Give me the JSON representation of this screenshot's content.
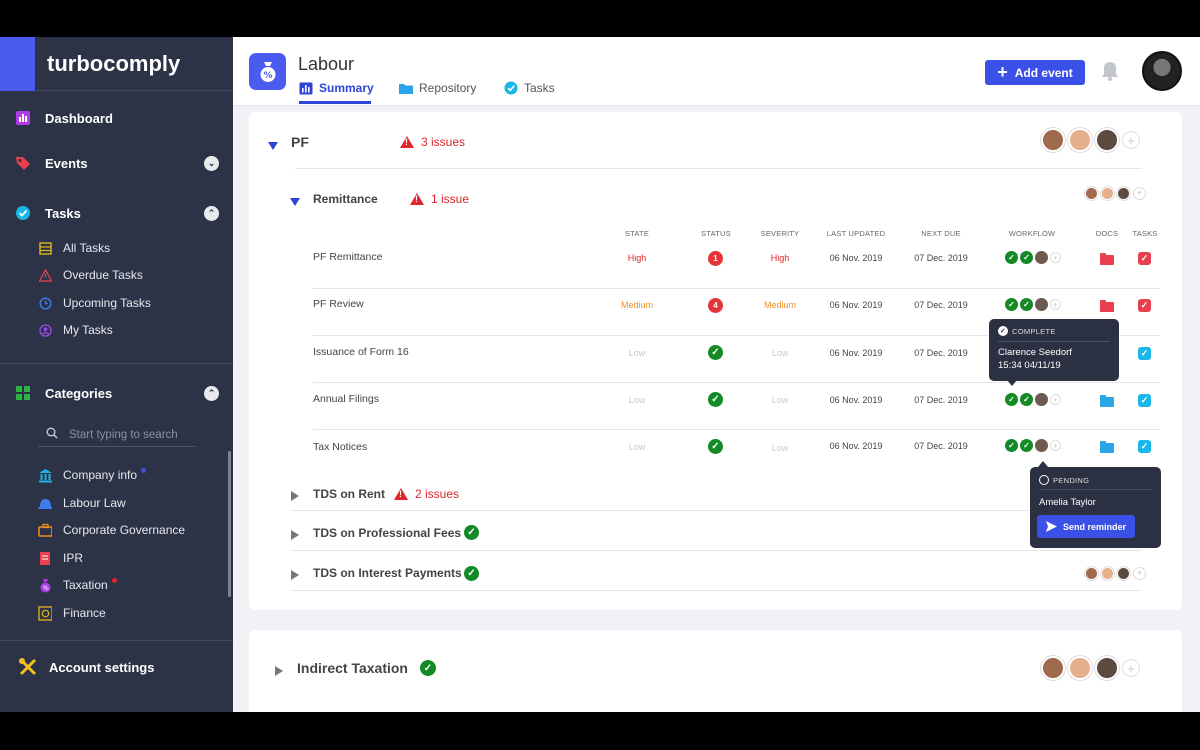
{
  "brand": {
    "name": "turbocomply"
  },
  "sidebar": {
    "dashboard": "Dashboard",
    "events": "Events",
    "tasks": "Tasks",
    "task_items": [
      {
        "label": "All Tasks",
        "icon": "list-icon"
      },
      {
        "label": "Overdue Tasks",
        "icon": "warning-icon"
      },
      {
        "label": "Upcoming Tasks",
        "icon": "clock-icon"
      },
      {
        "label": "My Tasks",
        "icon": "user-icon"
      }
    ],
    "categories": "Categories",
    "search_placeholder": "Start typing to search",
    "category_items": [
      {
        "label": "Company info",
        "dot": "#3b50e6"
      },
      {
        "label": "Labour Law"
      },
      {
        "label": "Corporate Governance"
      },
      {
        "label": "IPR"
      },
      {
        "label": "Taxation",
        "dot": "#e0242b"
      },
      {
        "label": "Finance"
      }
    ],
    "account_settings": "Account settings"
  },
  "header": {
    "title": "Labour",
    "tabs": [
      "Summary",
      "Repository",
      "Tasks"
    ],
    "active_tab": "Summary",
    "add_event": "Add event"
  },
  "section": {
    "title": "PF",
    "issues": "3 issues",
    "subsection": {
      "title": "Remittance",
      "issues": "1 issue"
    },
    "columns": [
      "STATE",
      "STATUS",
      "SEVERITY",
      "LAST UPDATED",
      "NEXT DUE",
      "WORKFLOW",
      "DOCS",
      "TASKS"
    ],
    "rows": [
      {
        "name": "PF Remittance",
        "state": "High",
        "status": "1",
        "severity": "High",
        "last_updated": "06 Nov. 2019",
        "next_due": "07 Dec. 2019"
      },
      {
        "name": "PF Review",
        "state": "Medium",
        "status": "4",
        "severity": "Medium",
        "last_updated": "06 Nov. 2019",
        "next_due": "07 Dec. 2019"
      },
      {
        "name": "Issuance of Form 16",
        "state": "Low",
        "status": "ok",
        "severity": "Low",
        "last_updated": "06 Nov. 2019",
        "next_due": "07 Dec. 2019"
      },
      {
        "name": "Annual Filings",
        "state": "Low",
        "status": "ok",
        "severity": "Low",
        "last_updated": "06 Nov. 2019",
        "next_due": "07 Dec. 2019"
      },
      {
        "name": "Tax Notices",
        "state": "Low",
        "status": "ok",
        "severity": "Low",
        "last_updated": "06 Nov. 2019",
        "next_due": "07 Dec. 2019"
      }
    ],
    "other_subsections": [
      {
        "title": "TDS on Rent",
        "issues": "2 issues"
      },
      {
        "title": "TDS on Professional Fees"
      },
      {
        "title": "TDS on Interest Payments"
      }
    ]
  },
  "tooltip_complete": {
    "status": "COMPLETE",
    "name": "Clarence Seedorf",
    "time": "15:34 04/11/19"
  },
  "tooltip_pending": {
    "status": "PENDING",
    "name": "Amelia Taylor",
    "button": "Send reminder"
  },
  "section2": {
    "title": "Indirect Taxation"
  },
  "colors": {
    "accent": "#3b50e6",
    "sidebar": "#2d3346",
    "danger": "#e0242b",
    "success": "#148a26",
    "warning": "#f0901f"
  }
}
